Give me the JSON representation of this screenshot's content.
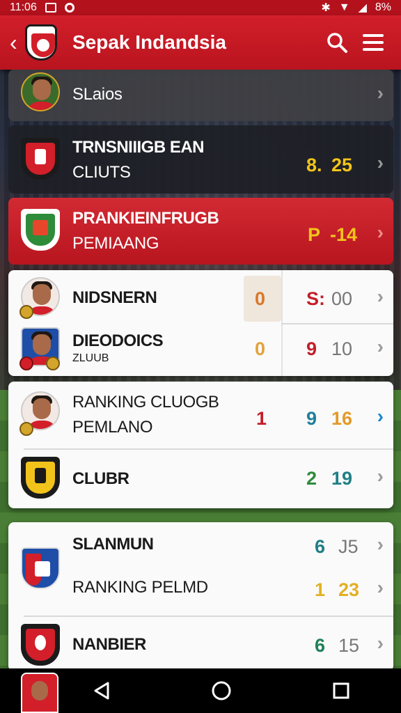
{
  "status_bar": {
    "time": "11:06",
    "battery": "8%"
  },
  "app_bar": {
    "title": "Sepak Indandsia"
  },
  "rows": [
    {
      "id": "r1",
      "line1": "SLaios",
      "line2": "",
      "score": "",
      "score2": ""
    },
    {
      "id": "r2",
      "line1": "TRNSNIIIGB EAN",
      "line2": "CLIUTS",
      "score": "8.",
      "score2": "25"
    },
    {
      "id": "r3",
      "line1": "PRANKIEINFRUGB",
      "line2": "PEMIAANG",
      "score": "P",
      "score2": "-14"
    },
    {
      "id": "r4",
      "line1": "NIDSNERN",
      "line2": "",
      "left_num": "0",
      "score": "S:",
      "score2": "00"
    },
    {
      "id": "r5",
      "line1": "DIEODOICS",
      "line2": "ZLUUB",
      "left_num": "0",
      "score": "9",
      "score2": "10"
    },
    {
      "id": "r6",
      "line1": "RANKING CLUOGB",
      "line2": "PEMLANO",
      "left_num": "1",
      "score": "9",
      "score2": "16"
    },
    {
      "id": "r7",
      "line1": "CLUBR",
      "line2": "",
      "score": "2",
      "score2": "19"
    },
    {
      "id": "r8",
      "line1": "SLANMUN",
      "line2": "",
      "score": "6",
      "score2": "J5"
    },
    {
      "id": "r9",
      "line1": "RANKING PELMD",
      "line2": "",
      "score": "1",
      "score2": "23"
    },
    {
      "id": "r10",
      "line1": "NANBIER",
      "line2": "",
      "score": "6",
      "score2": "15"
    }
  ],
  "colors": {
    "brand_red": "#d21f2a",
    "yellow": "#f2c41b",
    "orange": "#e39a28",
    "teal": "#1f7f86",
    "green": "#2e8b3a",
    "crimson": "#c41e2a",
    "blue": "#1a86c8"
  },
  "icons": {
    "back": "back-arrow-icon",
    "search": "search-icon",
    "menu": "menu-icon",
    "nav_back": "nav-back-icon",
    "nav_home": "nav-home-icon",
    "nav_recents": "nav-recents-icon"
  }
}
